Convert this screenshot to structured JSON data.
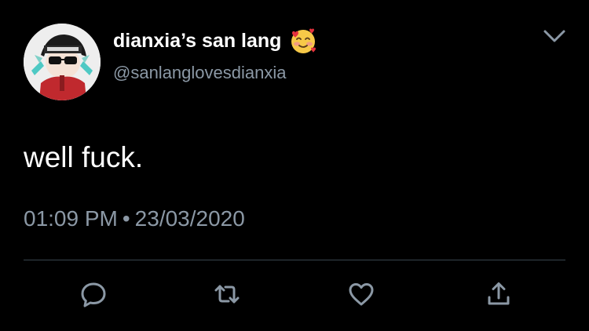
{
  "tweet": {
    "display_name": "dianxia’s san lang",
    "display_name_emoji": "smiling-face-with-hearts-icon",
    "handle": "@sanlanglovesdianxia",
    "text": "well fuck.",
    "time": "01:09 PM",
    "separator": "•",
    "date": "23/03/2020"
  },
  "actions": [
    {
      "icon": "reply-icon"
    },
    {
      "icon": "retweet-icon"
    },
    {
      "icon": "like-icon"
    },
    {
      "icon": "share-icon"
    }
  ],
  "colors": {
    "background": "#000000",
    "primary_text": "#ffffff",
    "secondary_text": "#8b98a5",
    "divider": "#38444d"
  }
}
